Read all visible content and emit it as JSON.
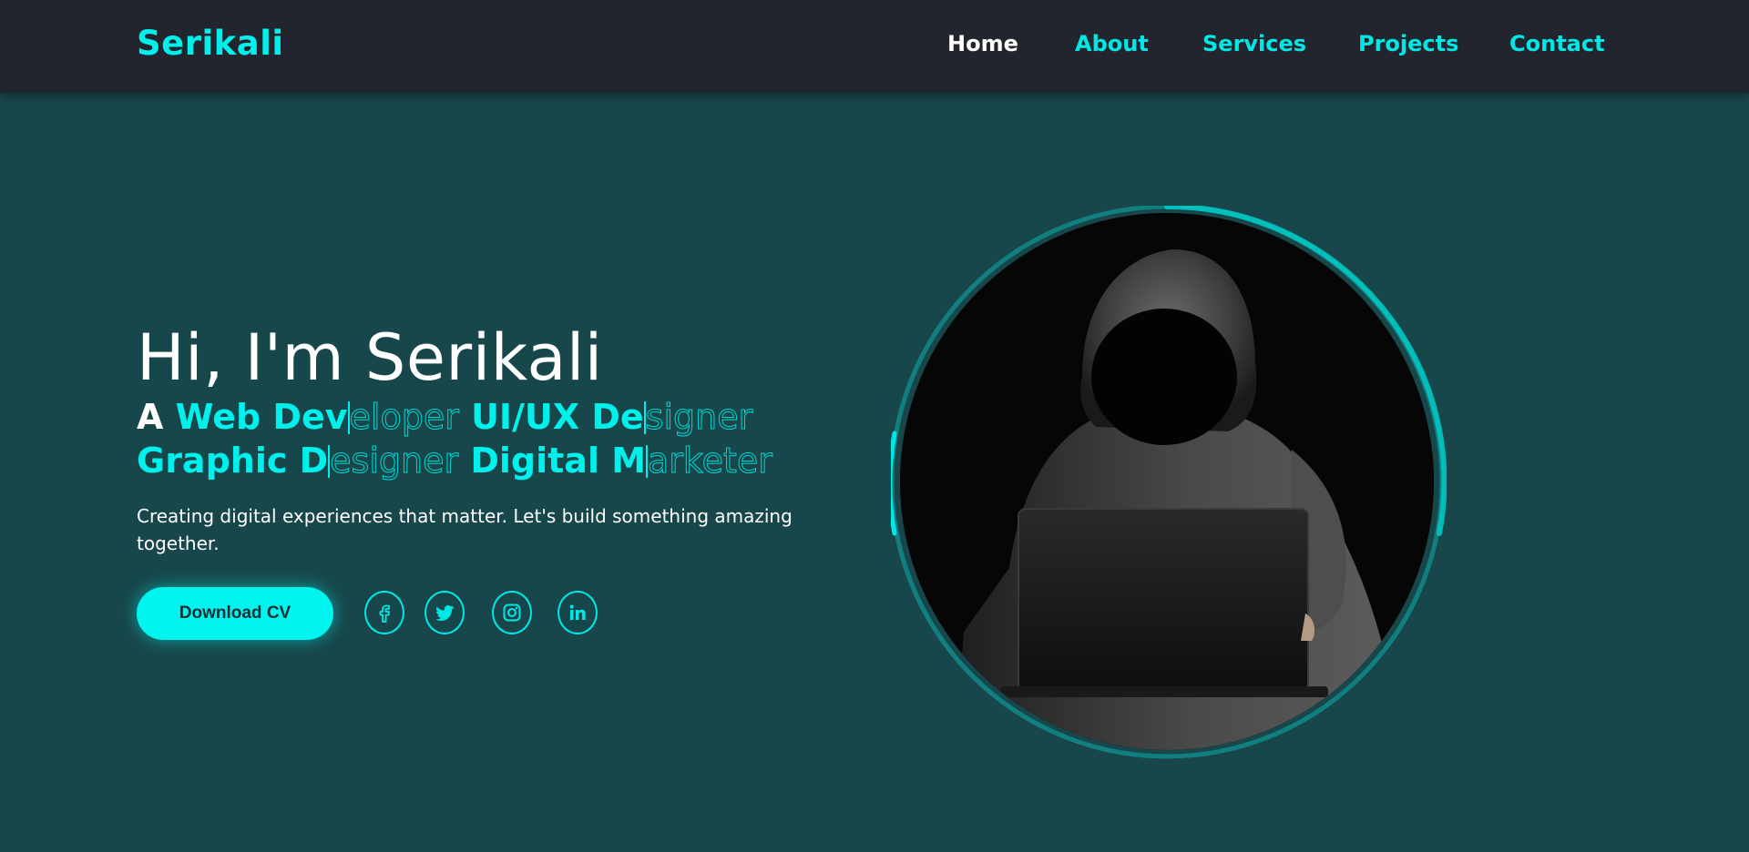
{
  "brand": {
    "logo": "Serikali"
  },
  "nav": {
    "items": [
      {
        "label": "Home",
        "active": true
      },
      {
        "label": "About",
        "active": false
      },
      {
        "label": "Services",
        "active": false
      },
      {
        "label": "Projects",
        "active": false
      },
      {
        "label": "Contact",
        "active": false
      }
    ]
  },
  "hero": {
    "greeting": "Hi, I'm Serikali",
    "role_prefix": "A",
    "roles": [
      {
        "typed": "Web Dev",
        "remaining": "eloper"
      },
      {
        "typed": "UI/UX De",
        "remaining": "signer"
      },
      {
        "typed": "Graphic D",
        "remaining": "esigner"
      },
      {
        "typed": "Digital M",
        "remaining": "arketer"
      }
    ],
    "tagline": "Creating digital experiences that matter. Let's build something amazing together.",
    "cta_label": "Download CV",
    "social_icons": [
      "facebook-icon",
      "twitter-icon",
      "instagram-icon",
      "linkedin-icon"
    ]
  },
  "colors": {
    "accent": "#00f0ec",
    "navbar_bg": "#22252d",
    "hero_bg": "#17474a"
  }
}
